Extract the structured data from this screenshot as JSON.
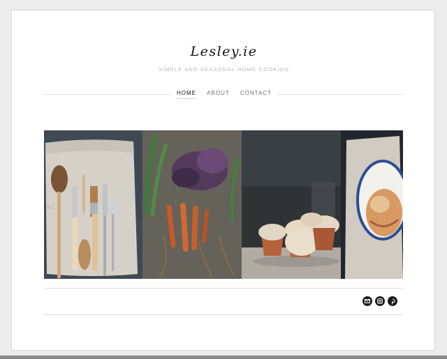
{
  "site": {
    "title": "Lesley.ie",
    "tagline": "SIMPLE AND SEASONAL HOME COOKING"
  },
  "nav": {
    "items": [
      {
        "label": "HOME",
        "active": true
      },
      {
        "label": "ABOUT",
        "active": false
      },
      {
        "label": "CONTACT",
        "active": false
      }
    ]
  },
  "gallery": {
    "photos": [
      {
        "subject": "wooden spoons and kitchen utensils on linen"
      },
      {
        "subject": "red cabbage and carrots with leeks on rustic wood"
      },
      {
        "subject": "bread rolls baked in terracotta pots"
      },
      {
        "subject": "bread in enamel dish on linen"
      }
    ]
  },
  "social": [
    {
      "icon": "email-icon"
    },
    {
      "icon": "instagram-icon"
    },
    {
      "icon": "pinterest-icon"
    }
  ],
  "colors": {
    "background": "#ececec",
    "card": "#ffffff",
    "text": "#111111",
    "tagline": "#b8b8b8",
    "icon_bg": "#1b1b1b"
  }
}
